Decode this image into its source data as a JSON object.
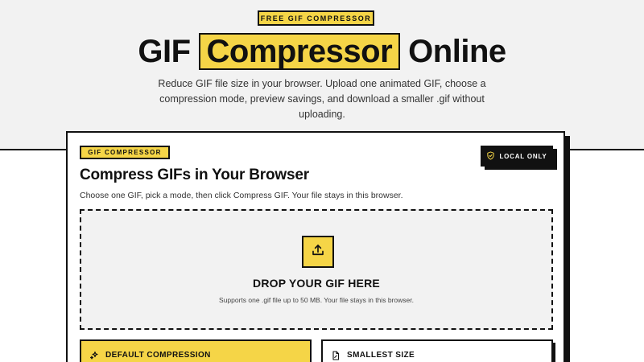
{
  "hero": {
    "badge": "FREE GIF COMPRESSOR",
    "title_before": "GIF",
    "title_highlight": "Compressor",
    "title_after": "Online",
    "subtitle": "Reduce GIF file size in your browser. Upload one animated GIF, choose a compression mode, preview savings, and download a smaller .gif without uploading."
  },
  "card": {
    "badge": "GIF COMPRESSOR",
    "local_badge": "LOCAL ONLY",
    "title": "Compress GIFs in Your Browser",
    "description": "Choose one GIF, pick a mode, then click Compress GIF. Your file stays in this browser.",
    "dropzone": {
      "title": "DROP YOUR GIF HERE",
      "subtitle": "Supports one .gif file up to 50 MB. Your file stays in this browser."
    },
    "modes": [
      {
        "label": "DEFAULT COMPRESSION",
        "icon": "sparkle-icon",
        "selected": true
      },
      {
        "label": "SMALLEST SIZE",
        "icon": "file-icon",
        "selected": false
      }
    ]
  },
  "colors": {
    "accent": "#f5d547",
    "ink": "#111111",
    "hero_bg": "#f2f2f2"
  }
}
